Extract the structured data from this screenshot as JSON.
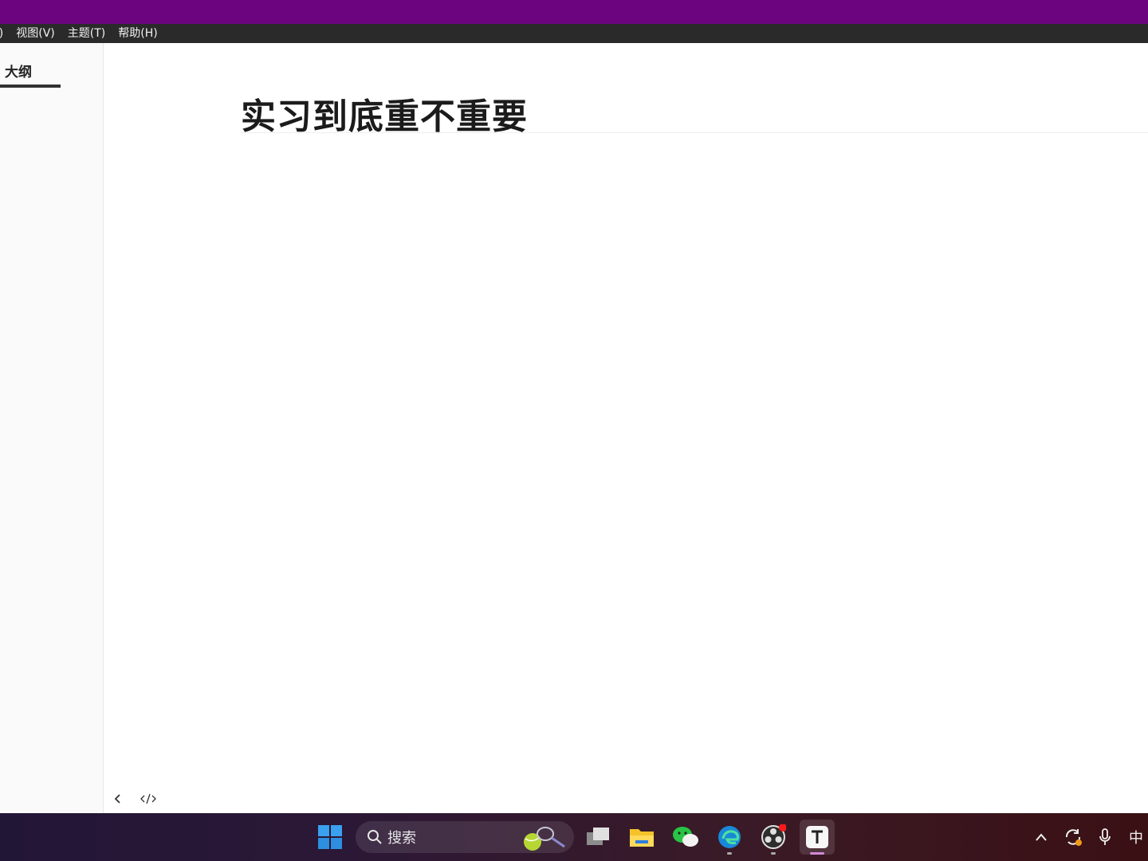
{
  "menubar": {
    "items": [
      {
        "label": "D)"
      },
      {
        "label": "视图(V)"
      },
      {
        "label": "主题(T)"
      },
      {
        "label": "帮助(H)"
      }
    ]
  },
  "sidebar": {
    "tab_label": "大纲"
  },
  "document": {
    "title": "实习到底重不重要"
  },
  "taskbar": {
    "search_placeholder": "搜索",
    "ime_indicator": "中",
    "apps": [
      "start-icon",
      "task-view-icon",
      "file-explorer-icon",
      "wechat-icon",
      "edge-icon",
      "obs-icon",
      "typora-icon"
    ]
  },
  "colors": {
    "titlebar": "#6c0480",
    "menubar": "#2a2a2a",
    "sidebar": "#fafafa"
  }
}
